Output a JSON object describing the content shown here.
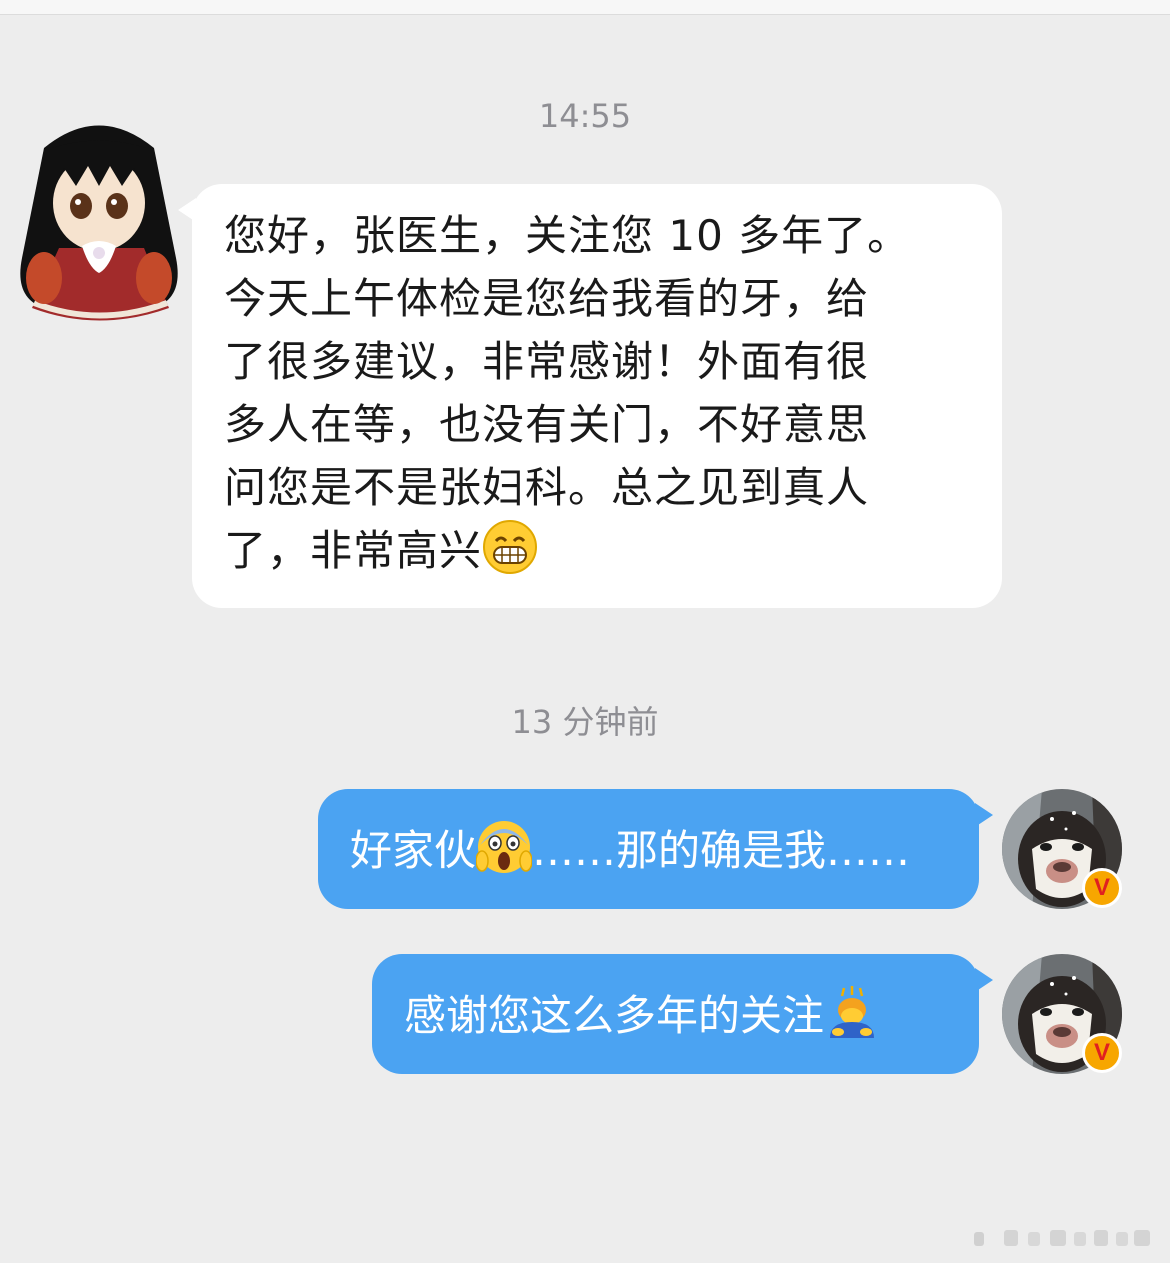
{
  "conversation": {
    "timestamps": [
      "14:55",
      "13 分钟前"
    ],
    "incoming": {
      "lines": [
        "您好，张医生，关注您 10 多年了。",
        "今天上午体检是您给我看的牙，给",
        "了很多建议，非常感谢！外面有很",
        "多人在等，也没有关门，不好意思",
        "问您是不是张妇科。总之见到真人",
        "了，非常高兴"
      ],
      "trailing_emoji": "grinning-face-icon"
    },
    "outgoing": [
      {
        "before_emoji": "好家伙",
        "emoji": "screaming-face-icon",
        "after_emoji": "……那的确是我……"
      },
      {
        "text": "感谢您这么多年的关注",
        "emoji": "bowing-person-icon"
      }
    ],
    "verified_badge": "V"
  },
  "colors": {
    "background": "#ededed",
    "incoming_bubble": "#ffffff",
    "outgoing_bubble": "#4ba3f2",
    "timestamp": "#8e8e93",
    "verified_badge": "#f7a600"
  }
}
